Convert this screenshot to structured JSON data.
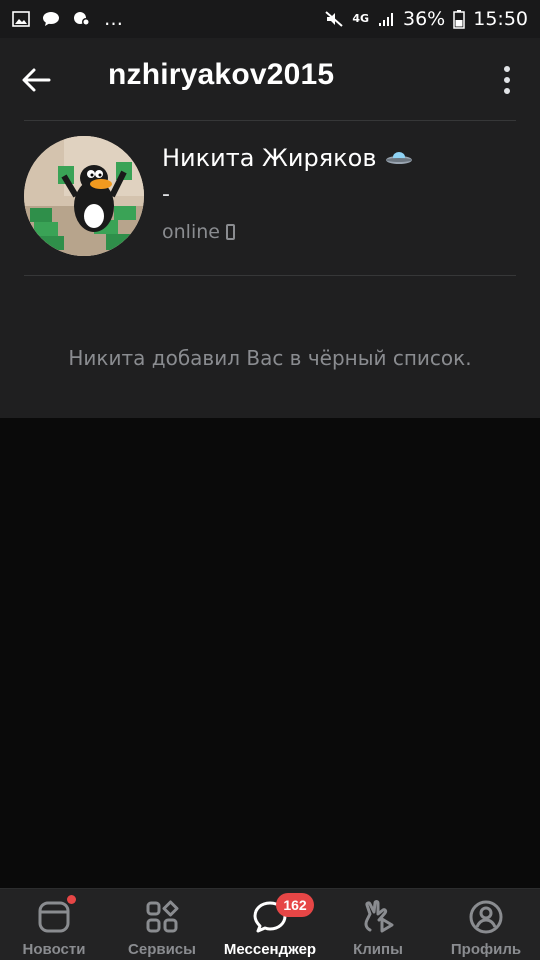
{
  "status_bar": {
    "left_icons": [
      "image-icon",
      "chat-bubble-icon",
      "cloud-settings-icon"
    ],
    "ellipsis": "…",
    "network": "4G",
    "battery": "36%",
    "time": "15:50"
  },
  "header": {
    "title": "nzhiryakov2015"
  },
  "profile": {
    "name": "Никита Жиряков",
    "name_emoji": "🛸",
    "status": "-",
    "online": "online"
  },
  "blocked_message": "Никита добавил Вас в чёрный список.",
  "tabs": [
    {
      "label": "Новости",
      "icon": "news-icon",
      "has_dot": true
    },
    {
      "label": "Сервисы",
      "icon": "services-icon"
    },
    {
      "label": "Мессенджер",
      "icon": "messenger-icon",
      "badge": "162",
      "active": true
    },
    {
      "label": "Клипы",
      "icon": "clips-icon"
    },
    {
      "label": "Профиль",
      "icon": "profile-icon"
    }
  ],
  "colors": {
    "page_bg": "#1f1f20",
    "empty_bg": "#0a0a0a",
    "accent_red": "#e64646",
    "muted_text": "#8a8c90"
  }
}
